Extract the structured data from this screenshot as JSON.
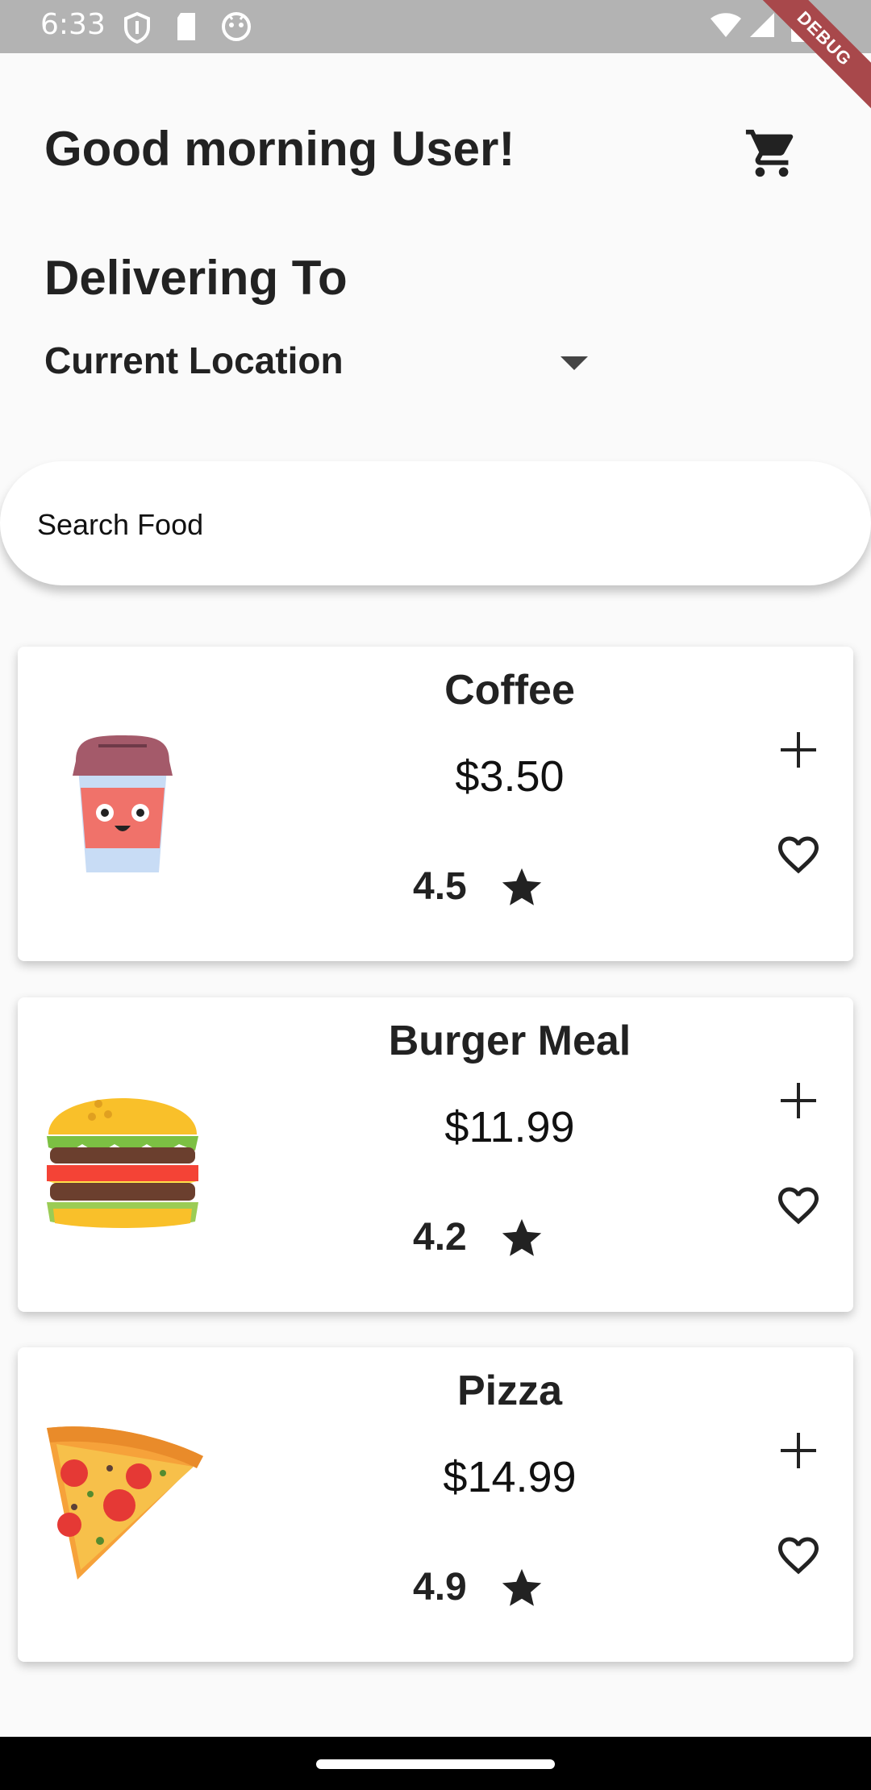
{
  "status_bar": {
    "time": "6:33"
  },
  "debug_banner": "DEBUG",
  "header": {
    "greeting": "Good morning User!"
  },
  "delivery": {
    "heading": "Delivering To",
    "location": "Current Location"
  },
  "search": {
    "placeholder": "Search Food"
  },
  "foods": [
    {
      "name": "Coffee",
      "price": "$3.50",
      "rating": "4.5",
      "image": "coffee-cup"
    },
    {
      "name": "Burger Meal",
      "price": "$11.99",
      "rating": "4.2",
      "image": "burger"
    },
    {
      "name": "Pizza",
      "price": "$14.99",
      "rating": "4.9",
      "image": "pizza-slice"
    }
  ],
  "icons": {
    "cart": "cart-icon",
    "dropdown": "dropdown-arrow-icon",
    "add": "plus-icon",
    "favorite": "heart-outline-icon",
    "rating": "star-icon"
  },
  "colors": {
    "background": "#fafafa",
    "card": "#ffffff",
    "status_bar": "#b3b3b3",
    "debug_banner": "#a8484b"
  }
}
